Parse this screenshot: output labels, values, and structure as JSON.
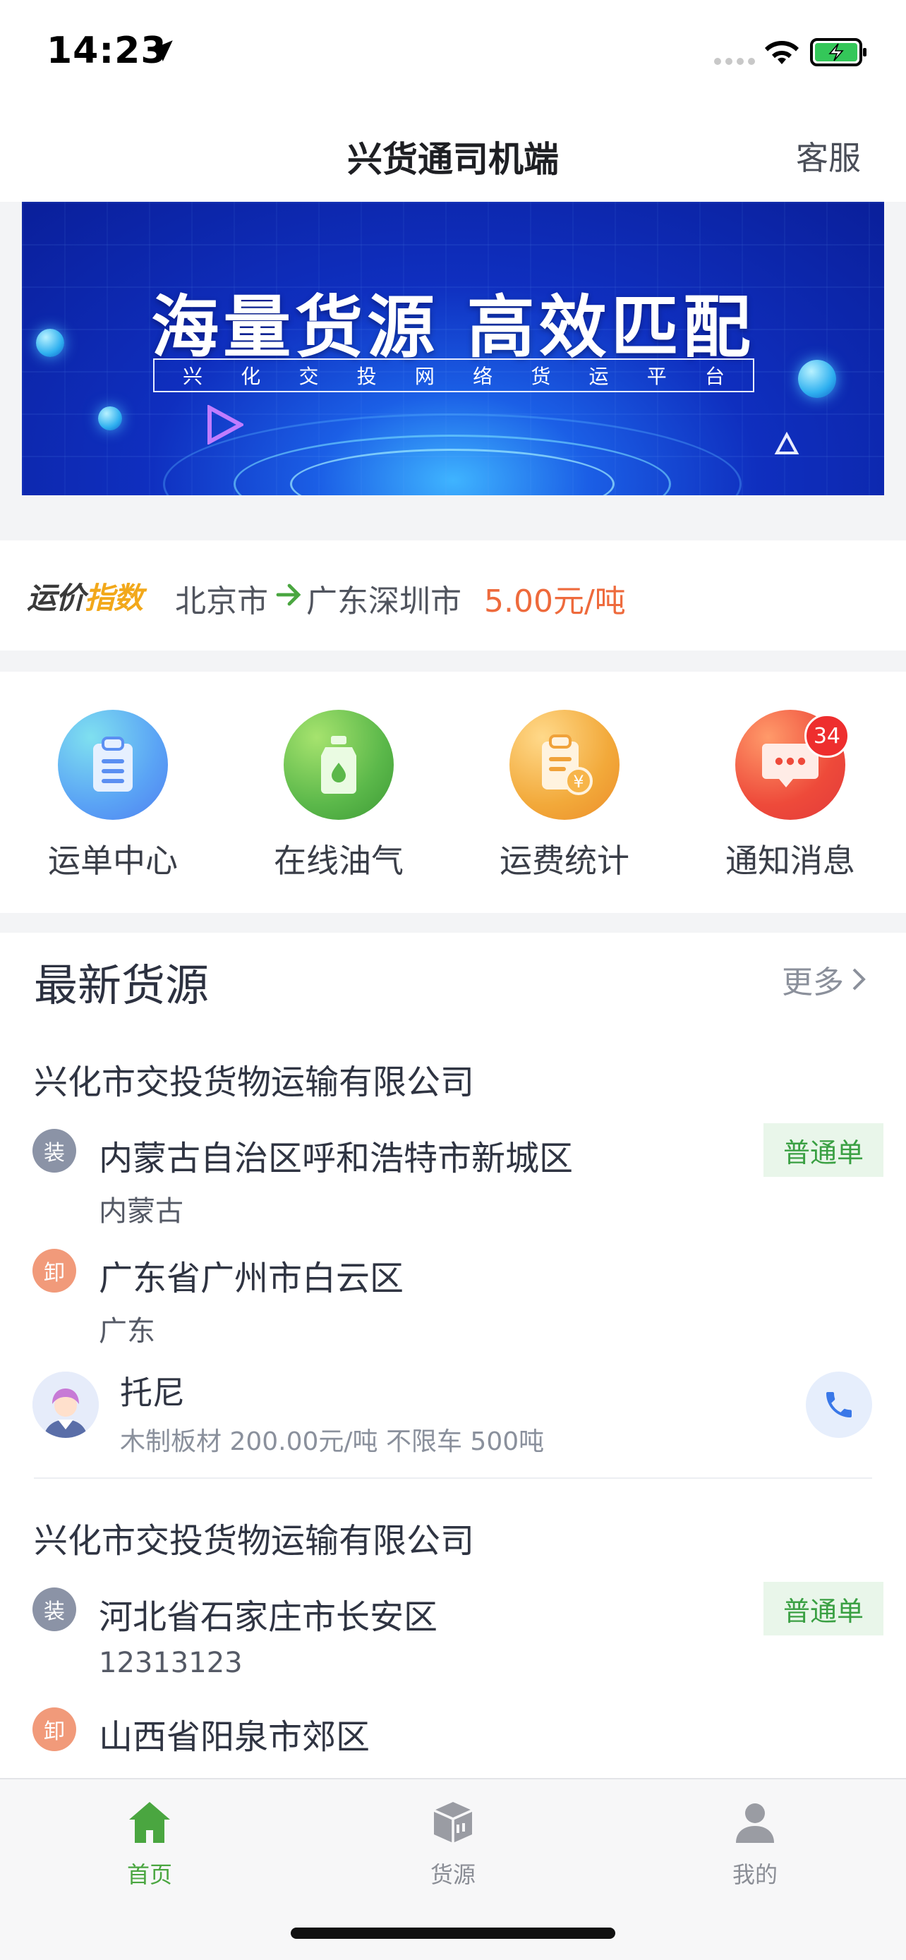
{
  "status_bar": {
    "time": "14:23"
  },
  "nav": {
    "title": "兴货通司机端",
    "service": "客服"
  },
  "banner": {
    "headline": "海量货源 高效匹配",
    "subtitle_chars": [
      "兴",
      "化",
      "交",
      "投",
      "网",
      "络",
      "货",
      "运",
      "平",
      "台"
    ]
  },
  "freight_index": {
    "logo_part1": "运价",
    "logo_part2": "指数",
    "from": "北京市",
    "to": "广东深圳市",
    "price": "5.00元/吨"
  },
  "menu": [
    {
      "label": "运单中心",
      "icon": "waybill-icon",
      "color": "#5aa3f5"
    },
    {
      "label": "在线油气",
      "icon": "oil-icon",
      "color": "#5bb84a"
    },
    {
      "label": "运费统计",
      "icon": "freight-stats-icon",
      "color": "#f2a93a"
    },
    {
      "label": "通知消息",
      "icon": "message-icon",
      "color": "#ee4a3a",
      "badge": "34"
    }
  ],
  "latest": {
    "title": "最新货源",
    "more": "更多",
    "cards": [
      {
        "company": "兴化市交投货物运输有限公司",
        "tag": "普通单",
        "load_badge": "装",
        "load_address": "内蒙古自治区呼和浩特市新城区",
        "load_sub": "内蒙古",
        "unload_badge": "卸",
        "unload_address": "广东省广州市白云区",
        "unload_sub": "广东",
        "contact_name": "托尼",
        "contact_detail": "木制板材 200.00元/吨 不限车 500吨"
      },
      {
        "company": "兴化市交投货物运输有限公司",
        "tag": "普通单",
        "load_badge": "装",
        "load_address": "河北省石家庄市长安区",
        "load_sub": "12313123",
        "unload_badge": "卸",
        "unload_address": "山西省阳泉市郊区"
      }
    ]
  },
  "tabs": [
    {
      "label": "首页",
      "icon": "home-icon",
      "active": true
    },
    {
      "label": "货源",
      "icon": "cargo-box-icon",
      "active": false
    },
    {
      "label": "我的",
      "icon": "profile-icon",
      "active": false
    }
  ],
  "colors": {
    "accent": "#4aa640",
    "price": "#ee6a3c",
    "tag_bg": "#e9f6ea"
  }
}
